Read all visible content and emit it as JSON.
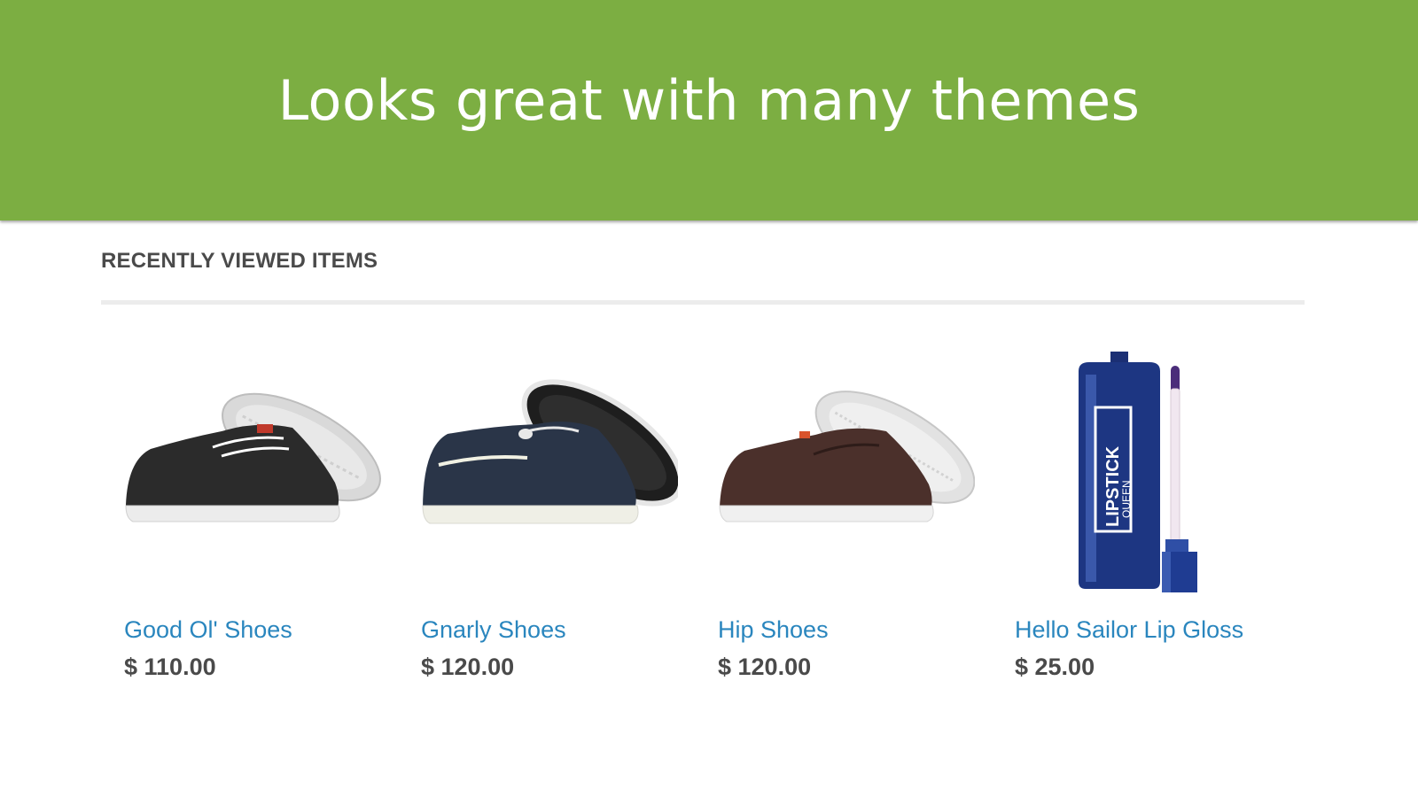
{
  "banner": {
    "title": "Looks great with many themes",
    "background_color": "#7cae42"
  },
  "recently_viewed": {
    "heading": "RECENTLY VIEWED ITEMS",
    "products": [
      {
        "name": "Good Ol' Shoes",
        "price": "$ 110.00",
        "image_icon": "black-sneaker-image"
      },
      {
        "name": "Gnarly Shoes",
        "price": "$ 120.00",
        "image_icon": "navy-boat-sneaker-image"
      },
      {
        "name": "Hip Shoes",
        "price": "$ 120.00",
        "image_icon": "brown-sneaker-image"
      },
      {
        "name": "Hello Sailor Lip Gloss",
        "price": "$ 25.00",
        "image_icon": "blue-lip-gloss-image"
      }
    ]
  },
  "colors": {
    "link": "#2a86be",
    "price": "#4a4a4a"
  },
  "brand_text": {
    "lipstick_line1": "LIPSTICK",
    "lipstick_line2": "QUEEN"
  }
}
